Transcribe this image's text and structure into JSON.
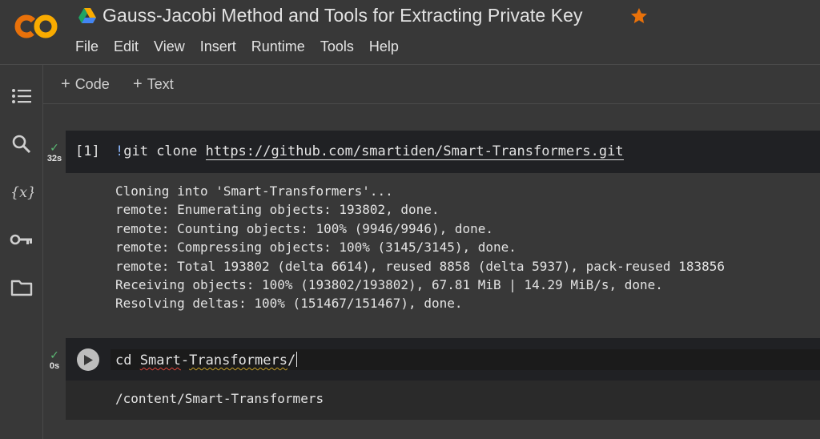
{
  "header": {
    "logo_text": "CO",
    "doc_title": "Gauss-Jacobi Method and Tools for Extracting Private Key",
    "menu": [
      "File",
      "Edit",
      "View",
      "Insert",
      "Runtime",
      "Tools",
      "Help"
    ]
  },
  "sidebar": {
    "icons": [
      "table-of-contents-icon",
      "search-icon",
      "variables-icon",
      "secrets-key-icon",
      "files-folder-icon"
    ]
  },
  "toolbar": {
    "add_code_label": "Code",
    "add_text_label": "Text"
  },
  "cells": [
    {
      "status": "✓",
      "duration": "32s",
      "execution_count": "[1]",
      "code_bang": "!",
      "code_cmd": "git clone ",
      "code_url": "https://github.com/smartiden/Smart-Transformers.git",
      "output": [
        "Cloning into 'Smart-Transformers'...",
        "remote: Enumerating objects: 193802, done.",
        "remote: Counting objects: 100% (9946/9946), done.",
        "remote: Compressing objects: 100% (3145/3145), done.",
        "remote: Total 193802 (delta 6614), reused 8858 (delta 5937), pack-reused 183856",
        "Receiving objects: 100% (193802/193802), 67.81 MiB | 14.29 MiB/s, done.",
        "Resolving deltas: 100% (151467/151467), done."
      ]
    },
    {
      "status": "✓",
      "duration": "0s",
      "code_cmd": "cd ",
      "code_arg_part1": "Smart",
      "code_arg_sep": "-",
      "code_arg_part2": "Transformers",
      "code_arg_tail": "/",
      "output": [
        "/content/Smart-Transformers"
      ]
    }
  ],
  "colors": {
    "background": "#383838",
    "code_background": "#202124",
    "logo_orange": "#f9ab00",
    "logo_dark_orange": "#e8710a",
    "star": "#e8710a",
    "check": "#5bb974",
    "bang": "#8ab4f8"
  }
}
